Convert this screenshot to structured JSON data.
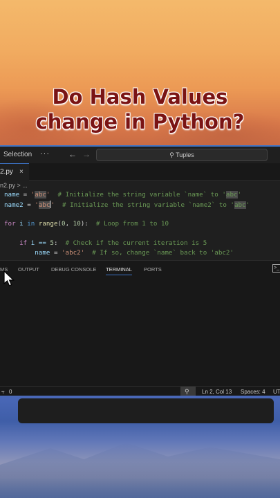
{
  "caption": {
    "line1": "Do Hash Values",
    "line2": "change in Python?"
  },
  "titlebar": {
    "menu_label": "Selection",
    "more_label": "···",
    "back_icon": "arrow-left-icon",
    "forward_icon": "arrow-right-icon",
    "search_text": "Tuples"
  },
  "tab": {
    "label": "2.py",
    "close": "×"
  },
  "breadcrumb": "n2.py > ...",
  "code": {
    "l1": {
      "var": "name",
      "eq": " = ",
      "q1": "'",
      "s": "abc",
      "q2": "'",
      "cmt_a": "  # Initialize the string variable `name` to '",
      "cmt_s": "abc",
      "cmt_b": "'"
    },
    "l2": {
      "var": "name2",
      "eq": " = ",
      "q1": "'",
      "s": "abc",
      "q2": "'",
      "cmt_a": "  # Initialize the string variable `name2` to '",
      "cmt_s": "abc",
      "cmt_b": "'"
    },
    "l4": {
      "for": "for",
      "i": " i ",
      "in": "in",
      "range": " range",
      "args_a": "(",
      "n0": "0",
      "comma": ", ",
      "n10": "10",
      "args_b": "):",
      "cmt": "  # Loop from 1 to 10"
    },
    "l6": {
      "indent": "    ",
      "if": "if",
      "rest": " i == ",
      "n5": "5",
      "colon": ":",
      "cmt": "  # Check if the current iteration is 5"
    },
    "l7": {
      "indent": "        ",
      "var": "name",
      "eq": " = ",
      "s": "'abc2'",
      "cmt": "  # If so, change `name` back to 'abc2'"
    }
  },
  "panel": {
    "tabs": [
      "MS",
      "OUTPUT",
      "DEBUG CONSOLE",
      "TERMINAL",
      "PORTS"
    ],
    "active_tab": "TERMINAL",
    "terminal_icon": "terminal-icon"
  },
  "statusbar": {
    "left": "0",
    "zoom_icon": "zoom-icon",
    "position": "Ln 2, Col 13",
    "spaces": "Spaces: 4",
    "encoding": "UT"
  }
}
